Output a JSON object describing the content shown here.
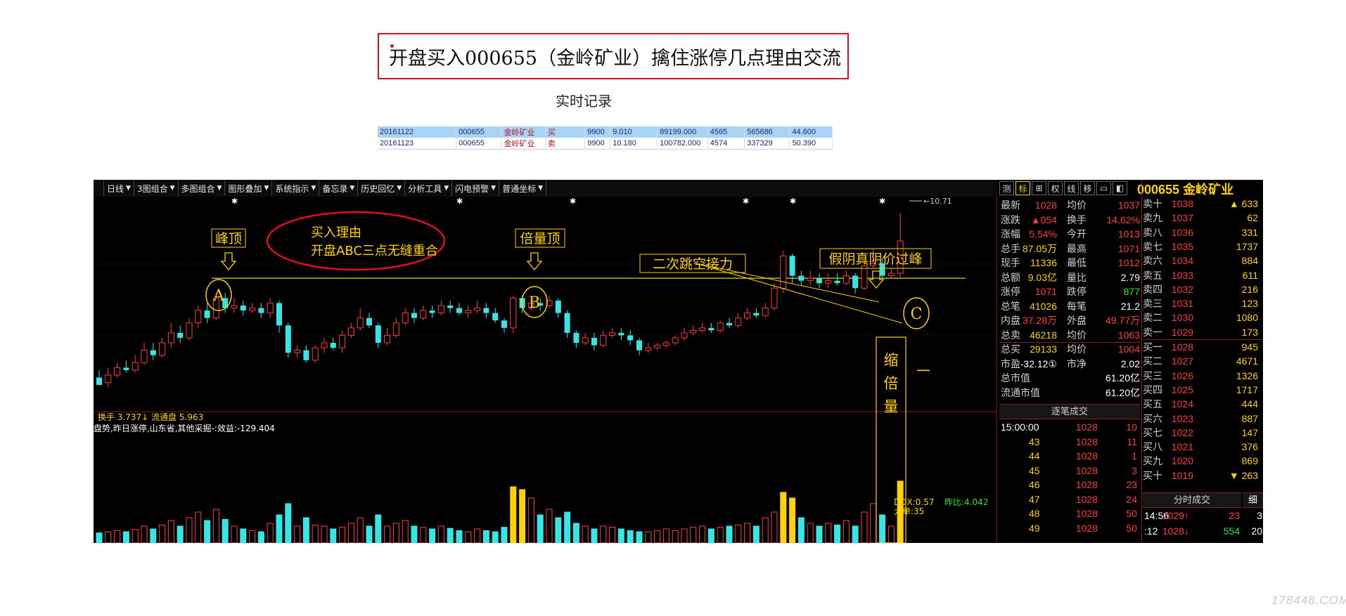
{
  "header": {
    "title": "开盘买入000655（金岭矿业）擒住涨停几点理由交流",
    "subtitle": "实时记录"
  },
  "trades": [
    [
      "20161122",
      "000655",
      "金岭矿业",
      "买",
      "9900",
      "9.010",
      "89199.000",
      "4565",
      "565686",
      "44.600"
    ],
    [
      "20161123",
      "000655",
      "金岭矿业",
      "卖",
      "9900",
      "10.180",
      "100782.000",
      "4574",
      "337329",
      "50.390"
    ]
  ],
  "toolbar": {
    "items": [
      "日线",
      "3图组合",
      "多图组合",
      "图形叠加",
      "系统指示",
      "备忘录",
      "历史回忆",
      "分析工具",
      "闪电预警",
      "普通坐标"
    ]
  },
  "annotations": {
    "peak": "峰顶",
    "double_volume_top": "倍量顶",
    "gap": "二次跳空接力",
    "fake_yin": "假阴真阴价过峰",
    "reason_line1": "买入理由",
    "reason_line2": "开盘ABC三点无缝重合",
    "label_a": "A",
    "label_b": "B",
    "label_c": "C",
    "shrink_volume": "缩\n倍\n量",
    "high_price": "10.71",
    "dash": "一"
  },
  "indicators": {
    "line1": "换手  3.737↓  流通盘  5.963",
    "line2": "盘势,昨日涨停,山东省,其他采掘-:效益:-129.404",
    "ddx": "DDX:0.57",
    "big_order": "大单:35",
    "yesterday_ratio": "昨比:4.042"
  },
  "chart_data": {
    "type": "candlestick",
    "series": [
      {
        "ohlc": [
          [
            7.4,
            7.25,
            7.55,
            7.3
          ],
          [
            7.3,
            7.45,
            7.6,
            7.2
          ],
          [
            7.45,
            7.6,
            7.7,
            7.4
          ],
          [
            7.6,
            7.55,
            7.75,
            7.5
          ],
          [
            7.55,
            7.7,
            7.85,
            7.5
          ],
          [
            7.7,
            7.95,
            8.1,
            7.65
          ],
          [
            7.95,
            7.85,
            8.1,
            7.75
          ],
          [
            7.85,
            8.1,
            8.2,
            7.8
          ],
          [
            8.1,
            8.3,
            8.5,
            8.0
          ],
          [
            8.3,
            8.2,
            8.45,
            8.1
          ],
          [
            8.2,
            8.5,
            8.6,
            8.15
          ],
          [
            8.5,
            8.75,
            8.85,
            8.4
          ],
          [
            8.75,
            8.6,
            8.9,
            8.5
          ],
          [
            8.6,
            9.0,
            9.1,
            8.55
          ],
          [
            9.0,
            8.8,
            9.1,
            8.7
          ],
          [
            8.8,
            8.85,
            9.0,
            8.7
          ],
          [
            8.85,
            8.75,
            8.95,
            8.65
          ],
          [
            8.75,
            8.8,
            8.9,
            8.7
          ],
          [
            8.8,
            8.7,
            8.9,
            8.6
          ],
          [
            8.7,
            8.9,
            9.0,
            8.6
          ],
          [
            8.9,
            8.45,
            8.95,
            8.3
          ],
          [
            8.45,
            7.9,
            8.5,
            7.8
          ],
          [
            7.9,
            7.95,
            8.05,
            7.8
          ],
          [
            7.95,
            7.75,
            8.05,
            7.7
          ],
          [
            7.75,
            8.0,
            8.05,
            7.7
          ],
          [
            8.0,
            8.1,
            8.2,
            7.9
          ],
          [
            8.1,
            8.0,
            8.2,
            7.95
          ],
          [
            8.0,
            8.25,
            8.35,
            7.9
          ],
          [
            8.25,
            8.4,
            8.5,
            8.2
          ],
          [
            8.4,
            8.6,
            8.8,
            8.35
          ],
          [
            8.6,
            8.45,
            8.7,
            8.4
          ],
          [
            8.45,
            8.1,
            8.5,
            8.0
          ],
          [
            8.1,
            8.25,
            8.4,
            8.05
          ],
          [
            8.25,
            8.5,
            8.6,
            8.2
          ],
          [
            8.5,
            8.7,
            8.8,
            8.45
          ],
          [
            8.7,
            8.6,
            8.8,
            8.5
          ],
          [
            8.6,
            8.75,
            8.85,
            8.55
          ],
          [
            8.75,
            8.7,
            8.85,
            8.6
          ],
          [
            8.7,
            8.85,
            8.95,
            8.65
          ],
          [
            8.85,
            8.8,
            8.95,
            8.7
          ],
          [
            8.8,
            8.7,
            8.9,
            8.65
          ],
          [
            8.7,
            8.75,
            8.85,
            8.6
          ],
          [
            8.75,
            8.8,
            8.95,
            8.7
          ],
          [
            8.8,
            8.7,
            8.9,
            8.6
          ],
          [
            8.7,
            8.55,
            8.8,
            8.5
          ],
          [
            8.55,
            8.4,
            8.6,
            8.3
          ],
          [
            8.4,
            9.0,
            9.05,
            8.3
          ],
          [
            9.0,
            8.8,
            9.05,
            8.7
          ],
          [
            8.8,
            8.9,
            9.0,
            8.75
          ],
          [
            8.9,
            8.85,
            9.0,
            8.75
          ],
          [
            8.85,
            8.95,
            9.05,
            8.8
          ],
          [
            8.95,
            8.7,
            9.0,
            8.6
          ],
          [
            8.7,
            8.3,
            8.75,
            8.2
          ],
          [
            8.3,
            8.1,
            8.35,
            8.0
          ],
          [
            8.1,
            8.2,
            8.3,
            8.05
          ],
          [
            8.2,
            8.05,
            8.3,
            7.95
          ],
          [
            8.05,
            8.25,
            8.35,
            8.0
          ],
          [
            8.25,
            8.3,
            8.4,
            8.2
          ],
          [
            8.3,
            8.25,
            8.4,
            8.15
          ],
          [
            8.25,
            8.15,
            8.35,
            8.05
          ],
          [
            8.15,
            7.95,
            8.2,
            7.85
          ],
          [
            7.95,
            8.0,
            8.1,
            7.9
          ],
          [
            8.0,
            8.05,
            8.1,
            7.95
          ],
          [
            8.05,
            8.1,
            8.15,
            8.0
          ],
          [
            8.1,
            8.2,
            8.25,
            8.05
          ],
          [
            8.2,
            8.3,
            8.4,
            8.15
          ],
          [
            8.3,
            8.35,
            8.45,
            8.25
          ],
          [
            8.35,
            8.4,
            8.5,
            8.3
          ],
          [
            8.4,
            8.35,
            8.5,
            8.3
          ],
          [
            8.35,
            8.5,
            8.55,
            8.3
          ],
          [
            8.5,
            8.45,
            8.6,
            8.4
          ],
          [
            8.45,
            8.6,
            8.7,
            8.4
          ],
          [
            8.6,
            8.7,
            8.8,
            8.55
          ],
          [
            8.7,
            8.65,
            8.8,
            8.6
          ],
          [
            8.65,
            8.8,
            8.9,
            8.6
          ],
          [
            8.8,
            9.2,
            9.3,
            8.75
          ],
          [
            9.2,
            9.85,
            9.95,
            9.1
          ],
          [
            9.85,
            9.45,
            9.9,
            9.3
          ],
          [
            9.45,
            9.35,
            9.55,
            9.25
          ],
          [
            9.35,
            9.4,
            9.55,
            9.25
          ],
          [
            9.4,
            9.3,
            9.5,
            9.2
          ],
          [
            9.3,
            9.35,
            9.5,
            9.2
          ],
          [
            9.35,
            9.3,
            9.5,
            9.25
          ],
          [
            9.3,
            9.45,
            9.55,
            9.25
          ],
          [
            9.45,
            9.2,
            9.5,
            9.1
          ],
          [
            9.2,
            9.65,
            9.75,
            9.15
          ],
          [
            9.65,
            9.7,
            10.0,
            9.6
          ],
          [
            9.7,
            9.45,
            9.8,
            9.4
          ],
          [
            9.45,
            9.5,
            9.6,
            9.4
          ],
          [
            9.5,
            10.15,
            10.71,
            9.4
          ]
        ],
        "volume": [
          0.18,
          0.2,
          0.22,
          0.2,
          0.24,
          0.3,
          0.25,
          0.32,
          0.4,
          0.3,
          0.45,
          0.55,
          0.4,
          0.6,
          0.42,
          0.3,
          0.25,
          0.22,
          0.2,
          0.35,
          0.5,
          0.7,
          0.3,
          0.45,
          0.32,
          0.3,
          0.25,
          0.28,
          0.35,
          0.45,
          0.3,
          0.5,
          0.3,
          0.35,
          0.4,
          0.3,
          0.28,
          0.25,
          0.3,
          0.26,
          0.22,
          0.2,
          0.25,
          0.22,
          0.2,
          0.28,
          1.0,
          0.95,
          0.8,
          0.5,
          0.6,
          0.45,
          0.55,
          0.35,
          0.3,
          0.25,
          0.3,
          0.28,
          0.25,
          0.22,
          0.2,
          0.2,
          0.22,
          0.25,
          0.22,
          0.25,
          0.28,
          0.3,
          0.25,
          0.28,
          0.3,
          0.32,
          0.35,
          0.3,
          0.45,
          0.55,
          0.9,
          0.8,
          0.45,
          0.35,
          0.3,
          0.35,
          0.32,
          0.4,
          0.3,
          0.55,
          0.7,
          0.5,
          0.3,
          1.1
        ]
      }
    ],
    "ylim": [
      6.8,
      10.9
    ]
  },
  "right_panel": {
    "tabs": [
      "测",
      "标",
      "⊞",
      "权",
      "线",
      "移",
      "▭",
      "◧"
    ],
    "code": "000655 金岭矿业",
    "left_quotes": [
      {
        "k": "最新",
        "v1": "1028",
        "k2": "均价",
        "v2": "1037"
      },
      {
        "k": "涨跌",
        "v1": "▲054",
        "k2": "换手",
        "v2": "14.62%"
      },
      {
        "k": "涨幅",
        "v1": "5.54%",
        "k2": "今开",
        "v2": "1013"
      },
      {
        "k": "总手",
        "v1": "87.05万",
        "k2": "最高",
        "v2": "1071"
      },
      {
        "k": "现手",
        "v1": "11336",
        "k2": "最低",
        "v2": "1012"
      },
      {
        "k": "总额",
        "v1": "9.03亿",
        "k2": "量比",
        "v2": "2.79"
      },
      {
        "k": "涨停",
        "v1": "1071",
        "k2": "跌停",
        "v2": "877"
      },
      {
        "k": "总笔",
        "v1": "41026",
        "k2": "每笔",
        "v2": "21.2"
      },
      {
        "k": "内盘",
        "v1": "37.28万",
        "k2": "外盘",
        "v2": "49.77万"
      },
      {
        "k": "总卖",
        "v1": "46218",
        "k2": "均价",
        "v2": "1063"
      },
      {
        "k": "总买",
        "v1": "29133",
        "k2": "均价",
        "v2": "1004"
      },
      {
        "k": "市盈",
        "v1": "-32.12①",
        "k2": "市净",
        "v2": "2.02"
      },
      {
        "k": "总市值",
        "v1": "",
        "k2": "",
        "v2": "61.20亿"
      },
      {
        "k": "流通市值",
        "v1": "",
        "k2": "",
        "v2": "61.20亿"
      }
    ],
    "order_book": [
      {
        "k": "卖十",
        "p": "1038",
        "q": "▲ 633"
      },
      {
        "k": "卖九",
        "p": "1037",
        "q": "62"
      },
      {
        "k": "卖八",
        "p": "1036",
        "q": "331"
      },
      {
        "k": "卖七",
        "p": "1035",
        "q": "1737"
      },
      {
        "k": "卖六",
        "p": "1034",
        "q": "884"
      },
      {
        "k": "卖五",
        "p": "1033",
        "q": "611"
      },
      {
        "k": "卖四",
        "p": "1032",
        "q": "216"
      },
      {
        "k": "卖三",
        "p": "1031",
        "q": "123"
      },
      {
        "k": "卖二",
        "p": "1030",
        "q": "1080"
      },
      {
        "k": "卖一",
        "p": "1029",
        "q": "173"
      },
      {
        "k": "买一",
        "p": "1028",
        "q": "945"
      },
      {
        "k": "买二",
        "p": "1027",
        "q": "4671"
      },
      {
        "k": "买三",
        "p": "1026",
        "q": "1326"
      },
      {
        "k": "买四",
        "p": "1025",
        "q": "1717"
      },
      {
        "k": "买五",
        "p": "1024",
        "q": "444"
      },
      {
        "k": "买六",
        "p": "1023",
        "q": "887"
      },
      {
        "k": "买七",
        "p": "1022",
        "q": "147"
      },
      {
        "k": "买八",
        "p": "1021",
        "q": "376"
      },
      {
        "k": "买九",
        "p": "1020",
        "q": "869"
      },
      {
        "k": "买十",
        "p": "1019",
        "q": "▼ 263"
      }
    ],
    "tick_header": "逐笔成交",
    "ticks": [
      {
        "t": "15:00:00",
        "p": "1028",
        "q": "10"
      },
      {
        "t": "43",
        "p": "1028",
        "q": "11"
      },
      {
        "t": "44",
        "p": "1028",
        "q": "1"
      },
      {
        "t": "45",
        "p": "1028",
        "q": "3"
      },
      {
        "t": "46",
        "p": "1028",
        "q": "23"
      },
      {
        "t": "47",
        "p": "1028",
        "q": "24"
      },
      {
        "t": "48",
        "p": "1028",
        "q": "50"
      },
      {
        "t": "49",
        "p": "1028",
        "q": "50"
      }
    ],
    "minute_header": "分时成交",
    "minute_ticks": [
      {
        "t": "14:56",
        "p": "1029↑",
        "q": "23",
        "n": "3"
      },
      {
        "t": ":12",
        "p": "1028↓",
        "q": "554",
        "n": "20"
      }
    ],
    "more": "细"
  },
  "watermark": "178448.COM",
  "colors": {
    "up": "#ff3b3b",
    "down": "#34e6e6",
    "accent": "#ffd200",
    "frame": "#e0101a"
  }
}
